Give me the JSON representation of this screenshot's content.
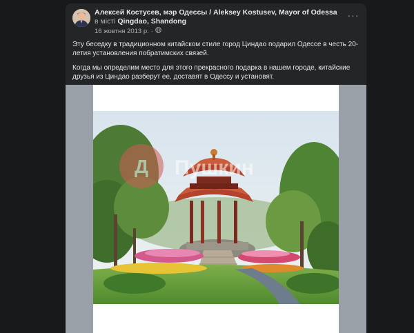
{
  "post": {
    "author": "Алексей Костусев, мэр Одессы / Aleksey Kostusev, Mayor of Odessa",
    "in_text": " в місті ",
    "location": "Qingdao, Shandong",
    "date": "16 жовтня 2013 р.",
    "date_separator": "·",
    "privacy_icon": "globe-icon",
    "more_icon": "more-options-icon",
    "more_label": "···",
    "paragraphs": [
      "Эту беседку в традиционном китайском стиле город Циндао подарил Одессе в честь 20-летия установления побратимских связей.",
      "Когда мы определим место для этого прекрасного подарка в нашем городе, китайские друзья из Циндао разберут ее, доставят в Одессу и установят."
    ],
    "watermark": "Пушкин"
  },
  "colors": {
    "background": "#18191a",
    "card": "#242526",
    "primary_text": "#e4e6eb",
    "secondary_text": "#b0b3b8"
  }
}
